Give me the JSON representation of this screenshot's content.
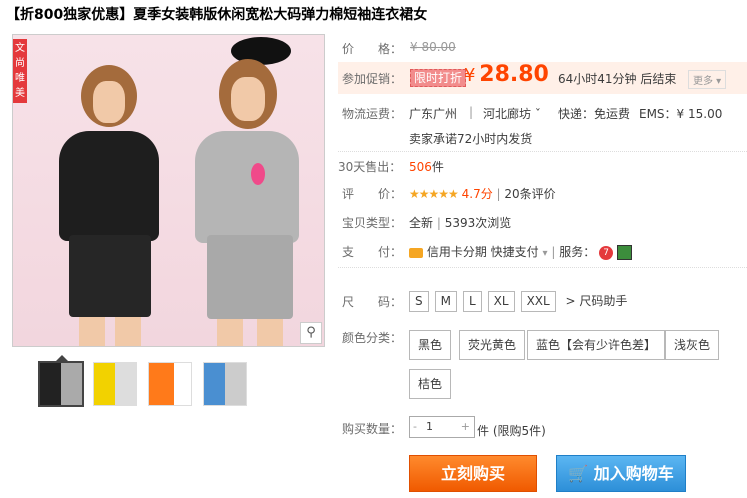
{
  "title": "【折800独家优惠】夏季女装韩版休闲宽松大码弹力棉短袖连衣裙女",
  "main_image": {
    "badge": "文尚唯美",
    "zoom_icon": "magnifier-icon"
  },
  "thumbnails": [
    {
      "name": "thumb-black-gray",
      "colors": [
        "#222222",
        "#aaaaaa"
      ]
    },
    {
      "name": "thumb-yellow",
      "colors": [
        "#f2d200",
        "#dddddd"
      ]
    },
    {
      "name": "thumb-orange",
      "colors": [
        "#ff7a1a",
        "#ffffff"
      ]
    },
    {
      "name": "thumb-blue",
      "colors": [
        "#4a8fd1",
        "#cccccc"
      ]
    }
  ],
  "price": {
    "label": "价　　格：",
    "value": "¥ 80.00"
  },
  "promo": {
    "label": "参加促销：",
    "tag": "限时打折",
    "currency": "¥",
    "value": "28.80",
    "countdown": "64小时41分钟 后结束",
    "more": "更多"
  },
  "shipping": {
    "label": "物流运费：",
    "from": "广东广州",
    "to": "河北廊坊",
    "express": "快递：免运费",
    "ems": "EMS：¥ 15.00",
    "promise": "卖家承诺72小时内发货"
  },
  "sales": {
    "label": "30天售出：",
    "count": "506",
    "unit": "件"
  },
  "rating": {
    "label": "评　　价：",
    "stars": "★★★★★",
    "score": "4.7分",
    "reviews": "20条评价"
  },
  "condition": {
    "label": "宝贝类型：",
    "value": "全新",
    "views": "5393次浏览"
  },
  "payment": {
    "label": "支　　付：",
    "card": "信用卡分期",
    "quick": "快捷支付",
    "service_label": "服务："
  },
  "sizes": {
    "label": "尺　　码：",
    "options": [
      "S",
      "M",
      "L",
      "XL",
      "XXL"
    ],
    "helper": "尺码助手"
  },
  "colors_sel": {
    "label": "颜色分类：",
    "options": [
      "黑色",
      "荧光黄色",
      "蓝色【会有少许色差】",
      "浅灰色",
      "桔色"
    ]
  },
  "quantity": {
    "label": "购买数量：",
    "value": "1",
    "unit": "件 (限购5件)",
    "minus": "-",
    "plus": "+"
  },
  "buttons": {
    "buy": "立刻购买",
    "cart": "加入购物车"
  }
}
